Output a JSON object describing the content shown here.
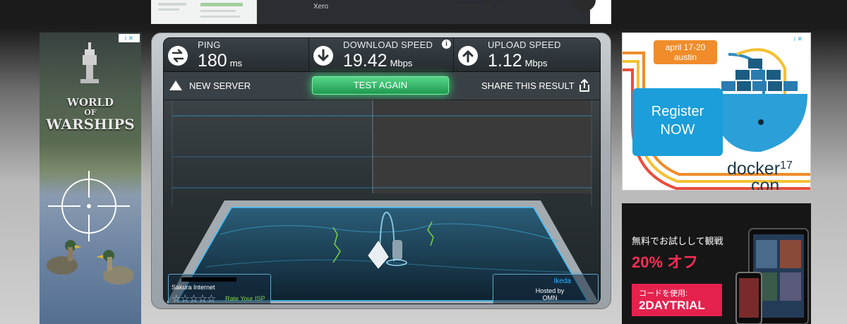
{
  "top_ad": {
    "brand": "Xero",
    "tagline": "invoicing with Xero."
  },
  "left_ad": {
    "adchoice": "i ✕",
    "logo_line1": "WORLD",
    "logo_line2": "OF",
    "logo_line3": "WARSHIPS"
  },
  "speedtest": {
    "ping": {
      "label": "PING",
      "value": "180",
      "unit": "ms",
      "icon": "ping-icon"
    },
    "download": {
      "label": "DOWNLOAD SPEED",
      "value": "19.42",
      "unit": "Mbps",
      "icon": "download-arrow-icon"
    },
    "upload": {
      "label": "UPLOAD SPEED",
      "value": "1.12",
      "unit": "Mbps",
      "icon": "upload-arrow-icon"
    },
    "info_icon": "i",
    "new_server": "NEW SERVER",
    "test_again": "TEST AGAIN",
    "share": "SHARE THIS RESULT",
    "isp": {
      "name": "Sakura Internet",
      "stars": "☆☆☆☆☆",
      "rate_label": "Rate Your ISP"
    },
    "host": {
      "city": "Ikeda",
      "hosted_by": "Hosted by",
      "host_name": "OMN"
    },
    "colors": {
      "accent_green": "#2fc86a",
      "map_blue": "#2fb4ff"
    }
  },
  "docker_ad": {
    "adchoice": "i ✕",
    "date_line1": "april 17-20",
    "date_line2": "austin",
    "register_line1": "Register",
    "register_line2": "NOW",
    "brand": "docker",
    "brand_year": "17",
    "brand_con": "con"
  },
  "promo_ad": {
    "line1": "無料でお試しして観戦",
    "line2": "20% オフ",
    "code_label": "コードを使用:",
    "code_value": "2DAYTRIAL"
  }
}
